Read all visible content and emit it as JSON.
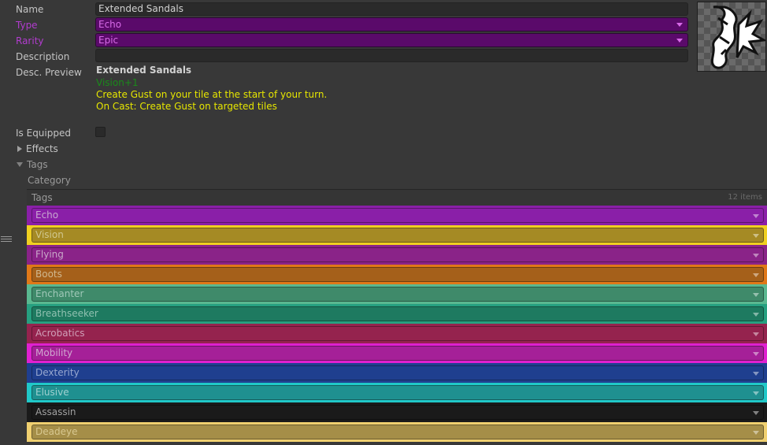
{
  "fields": {
    "name_label": "Name",
    "name_value": "Extended Sandals",
    "type_label": "Type",
    "type_value": "Echo",
    "rarity_label": "Rarity",
    "rarity_value": "Epic",
    "description_label": "Description",
    "description_value": "",
    "desc_preview_label": "Desc. Preview",
    "is_equipped_label": "Is Equipped",
    "is_equipped": false
  },
  "preview": {
    "title": "Extended Sandals",
    "lines": [
      {
        "text": "Vision+1",
        "color": "#1a8a1a"
      },
      {
        "text": "Create Gust on your tile at the start of your turn.",
        "color": "#e6e600"
      },
      {
        "text": "On Cast: Create Gust on targeted tiles",
        "color": "#e6e600"
      }
    ]
  },
  "foldouts": {
    "effects": "Effects",
    "tags": "Tags",
    "category": "Category"
  },
  "tags_list": {
    "header": "Tags",
    "count": "12 items",
    "items": [
      {
        "label": "Echo",
        "color": "#8a1fa8",
        "text_color": "#c8a8d0"
      },
      {
        "label": "Vision",
        "color": "#a58a24",
        "text_color": "#d0c890",
        "outline": "#f0d020"
      },
      {
        "label": "Flying",
        "color": "#8a2388",
        "text_color": "#c8a8c8"
      },
      {
        "label": "Boots",
        "color": "#a5601a",
        "text_color": "#d0b890",
        "outline": "#e07818"
      },
      {
        "label": "Enchanter",
        "color": "#3f8a6a",
        "text_color": "#a0c8b8",
        "outline": "#5ab890"
      },
      {
        "label": "Breathseeker",
        "color": "#1e7a60",
        "text_color": "#90c0b0",
        "outline": "#26a080"
      },
      {
        "label": "Acrobatics",
        "color": "#95234e",
        "text_color": "#d0a0b8"
      },
      {
        "label": "Mobility",
        "color": "#a52098",
        "text_color": "#d0a8d0",
        "outline": "#e020d0"
      },
      {
        "label": "Dexterity",
        "color": "#1f3f8f",
        "text_color": "#98a8d0"
      },
      {
        "label": "Elusive",
        "color": "#1f9090",
        "text_color": "#a0d0d0",
        "outline": "#20c8c8"
      },
      {
        "label": "Assassin",
        "color": "#1a1a1a",
        "text_color": "#a0a0a0"
      },
      {
        "label": "Deadeye",
        "color": "#a58e48",
        "text_color": "#d8c890",
        "outline": "#f0d070"
      }
    ]
  }
}
